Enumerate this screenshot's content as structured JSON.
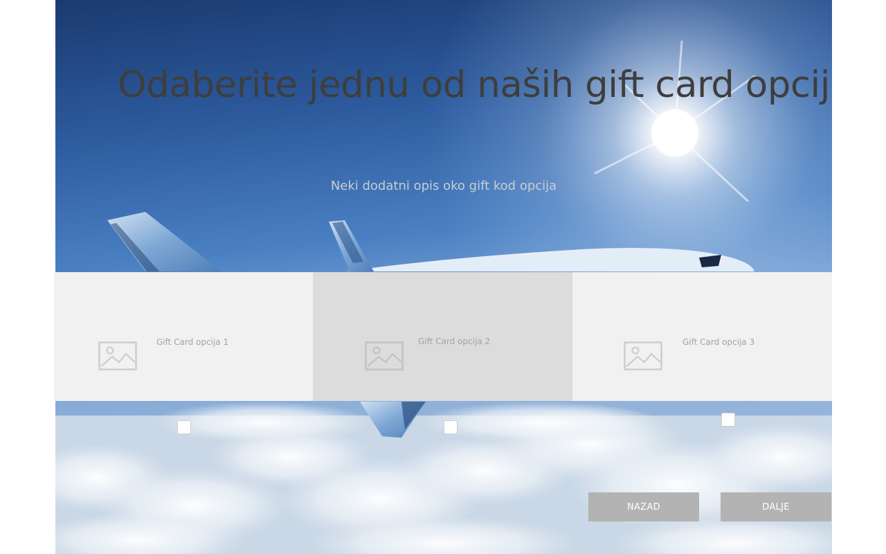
{
  "hero": {
    "title": "Odaberite jednu od naših gift card opcija",
    "subtitle": "Neki dodatni opis oko gift kod opcija"
  },
  "options": [
    {
      "label": "Gift Card opcija 1",
      "icon": "image-placeholder-icon",
      "checked": false,
      "highlighted": false
    },
    {
      "label": "Gift Card opcija 2",
      "icon": "image-placeholder-icon",
      "checked": false,
      "highlighted": true
    },
    {
      "label": "Gift Card opcija 3",
      "icon": "image-placeholder-icon",
      "checked": false,
      "highlighted": false
    }
  ],
  "buttons": {
    "back": "NAZAD",
    "next": "DALJE"
  },
  "colors": {
    "card": "#f1f1f1",
    "card_highlighted": "#dcdcdc",
    "button": "#b3b3b3",
    "button_text": "#ffffff",
    "title_text": "#3e3e3e",
    "subtitle_text": "#c7cdd6",
    "sky_top": "#1d3f76",
    "sky_mid": "#4a80c2"
  }
}
